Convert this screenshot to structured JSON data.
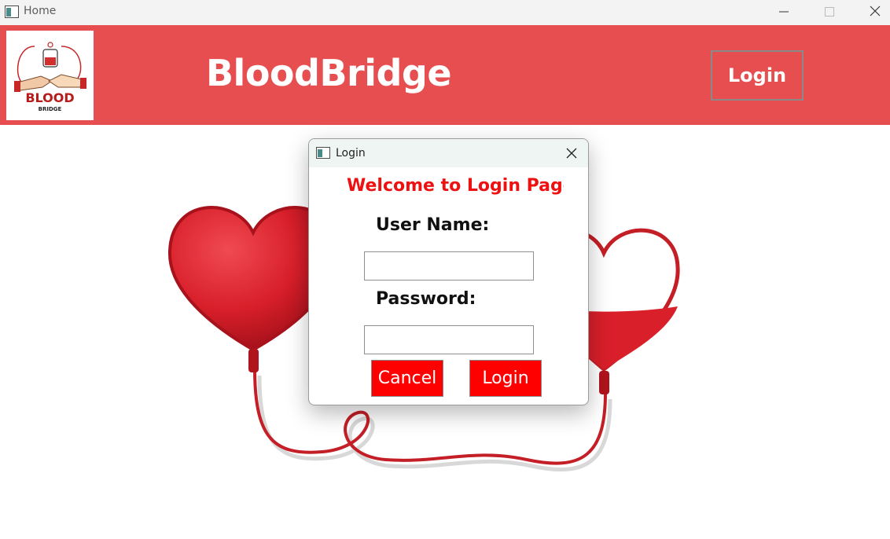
{
  "window": {
    "title": "Home",
    "app_icon": "window-app-icon",
    "controls": [
      "minimize-icon",
      "maximize-icon",
      "close-icon"
    ]
  },
  "header": {
    "brand": "BloodBridge",
    "login_label": "Login",
    "logo": {
      "text_main": "BLOOD",
      "text_sub": "BRIDGE"
    },
    "background_color": "#e64e50"
  },
  "dialog": {
    "title": "Login",
    "welcome": "Welcome to Login Page",
    "username_label": "User Name:",
    "username_value": "",
    "password_label": "Password:",
    "password_value": "",
    "cancel_label": "Cancel",
    "login_label": "Login",
    "button_color": "#ff0000",
    "welcome_color": "#ee1111"
  },
  "illustration": "two-hearts-blood-transfusion"
}
